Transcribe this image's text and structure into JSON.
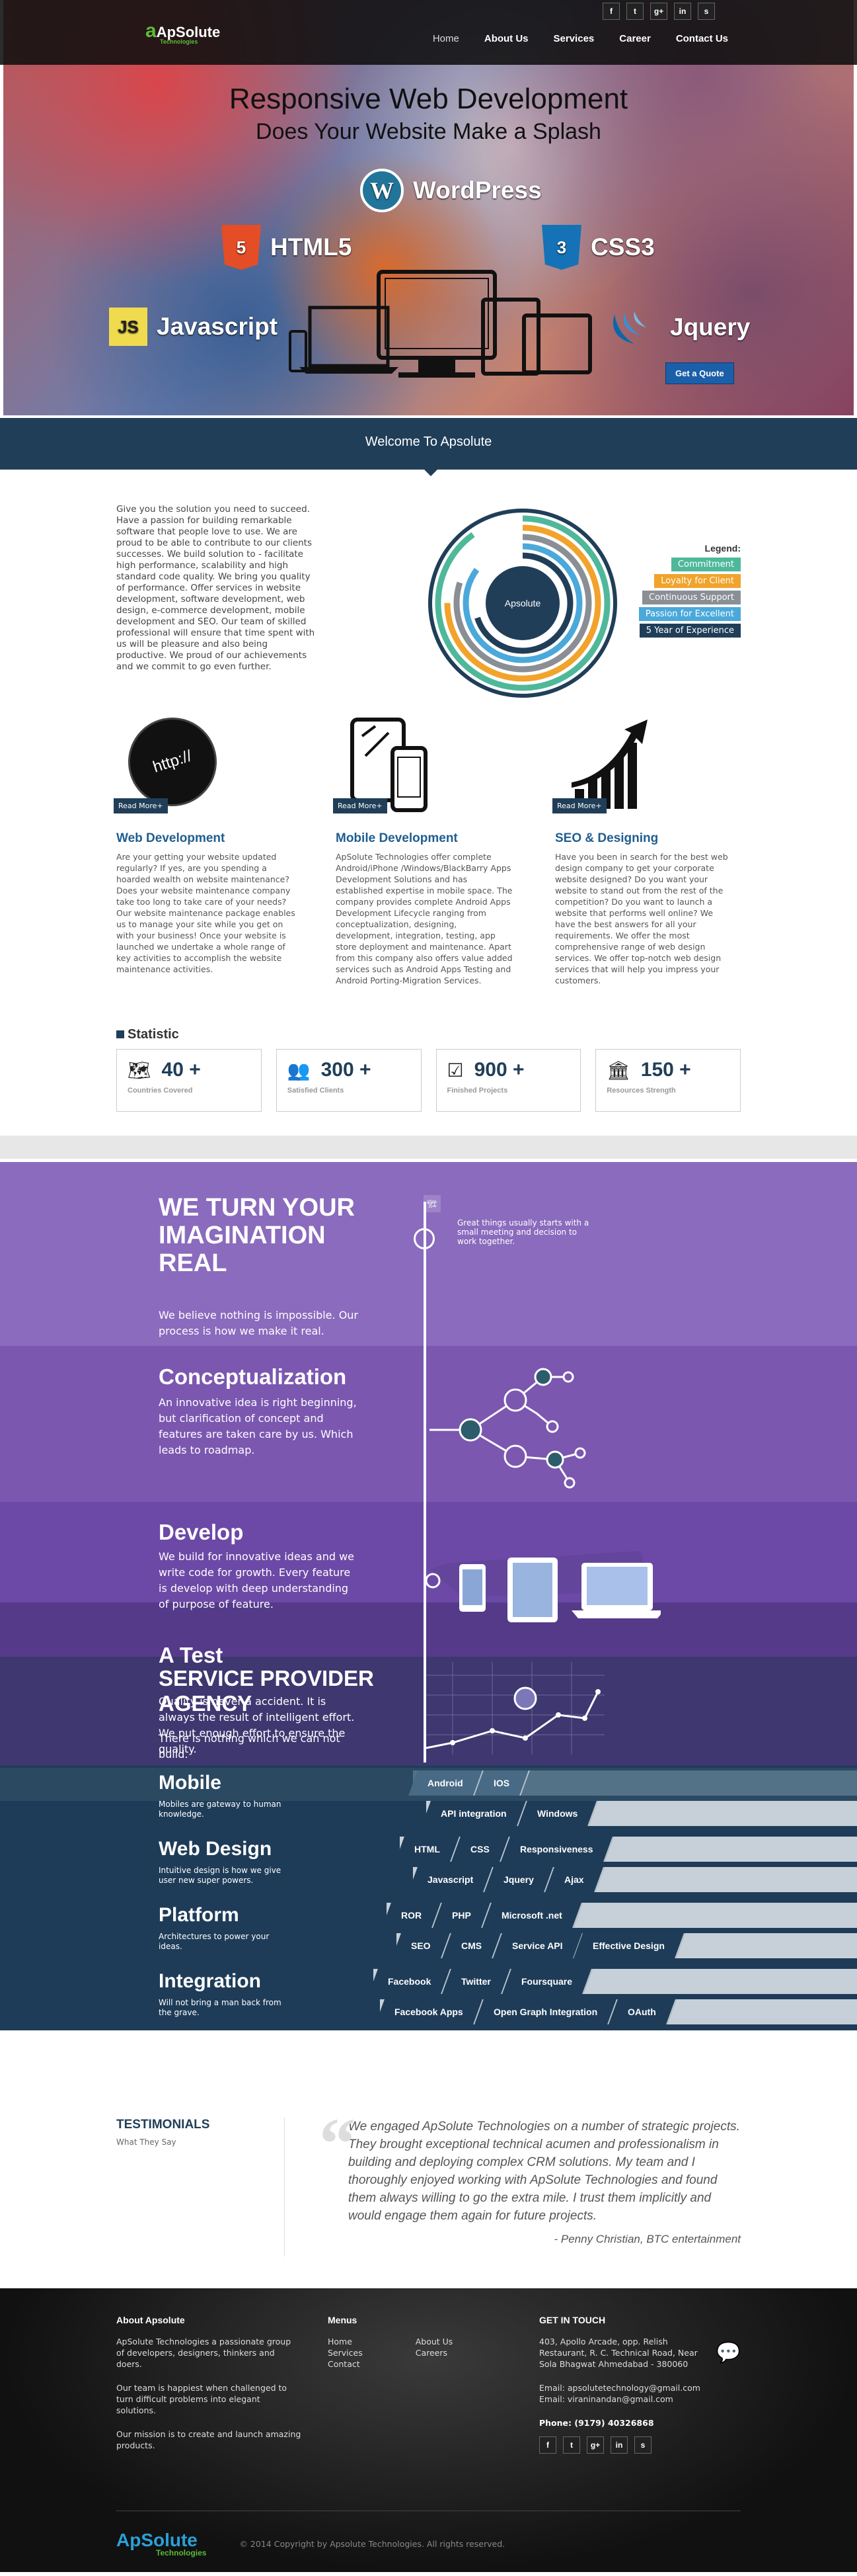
{
  "header": {
    "logo": {
      "mark": "a",
      "text": "ApSolute",
      "tagline": "Technologies"
    },
    "nav": [
      "Home",
      "About Us",
      "Services",
      "Career",
      "Contact Us"
    ],
    "social": [
      "f",
      "t",
      "g+",
      "in",
      "s"
    ]
  },
  "hero": {
    "title": "Responsive Web Development",
    "subtitle": "Does Your Website Make a Splash",
    "techs": [
      {
        "label": "WordPress",
        "icon": "W",
        "color": "#21759b"
      },
      {
        "label": "HTML5",
        "icon": "5",
        "color": "#e44d26"
      },
      {
        "label": "CSS3",
        "icon": "3",
        "color": "#1572b6"
      },
      {
        "label": "Javascript",
        "icon": "JS",
        "color": "#f0db4f"
      },
      {
        "label": "Jquery",
        "icon": "",
        "color": "#0868ac"
      }
    ],
    "quote_button": "Get a Quote"
  },
  "welcome": {
    "title": "Welcome To Apsolute"
  },
  "about": {
    "text": "Give you the solution you need to succeed. Have a passion for building remarkable software that people love to use. We are proud to be able to contribute to our clients successes. We build solution to - facilitate high performance, scalability and high standard code quality. We bring you quality of performance. Offer services in website development, software development, web design, e-commerce development, mobile development and SEO. Our team of skilled professional will ensure that time spent with us will be pleasure and also being productive. We proud of our achievements and we commit to go even further.",
    "donut_center": "Apsolute",
    "legend_title": "Legend:",
    "legend": [
      {
        "label": "Commitment",
        "color": "#4fb89b",
        "value": 0.9
      },
      {
        "label": "Loyalty for Client",
        "color": "#f1a32c",
        "value": 0.75
      },
      {
        "label": "Continuous Support",
        "color": "#8a8f95",
        "value": 0.8
      },
      {
        "label": "Passion for Excellent",
        "color": "#4aa9da",
        "value": 0.85
      },
      {
        "label": "5 Year of Experience",
        "color": "#203e58",
        "value": 0.7
      }
    ]
  },
  "services": [
    {
      "title": "Web Development",
      "read_more": "Read More+",
      "img_text": "http://",
      "text": "Are your getting your website updated regularly? If yes, are you spending a hoarded wealth on website maintenance? Does your website maintenance company take too long to take care of your needs? Our website maintenance package enables us to manage your site while you get on with your business! Once your website is launched we undertake a whole range of key activities to accomplish the website maintenance activities."
    },
    {
      "title": "Mobile Development",
      "read_more": "Read More+",
      "text": "ApSolute Technologies offer complete Android/iPhone /Windows/BlackBarry Apps Development Solutions and has established expertise in mobile space. The company provides complete Android Apps Development Lifecycle ranging from conceptualization, designing, development, integration, testing, app store deployment and maintenance. Apart from this company also offers value added services such as Android Apps Testing and Android Porting-Migration Services."
    },
    {
      "title": "SEO & Designing",
      "read_more": "Read More+",
      "text": "Have you been in search for the best web design company to get your corporate website designed? Do you want your website to stand out from the rest of the competition? Do you want to launch a website that performs well online? We have the best answers for all your requirements. We offer the most comprehensive range of web design services. We offer top-notch web design services that will help you impress your customers."
    }
  ],
  "statistics": {
    "title": "Statistic",
    "items": [
      {
        "value": "40 +",
        "label": "Countries Covered",
        "icon": "globe-icon"
      },
      {
        "value": "300 +",
        "label": "Satisfied Clients",
        "icon": "users-icon"
      },
      {
        "value": "900 +",
        "label": "Finished Projects",
        "icon": "checklist-icon"
      },
      {
        "value": "150 +",
        "label": "Resources Strength",
        "icon": "team-icon"
      }
    ]
  },
  "process": {
    "intro_title": "WE TURN YOUR IMAGINATION REAL",
    "intro_text": "We believe nothing is impossible. Our process is how we make it real.",
    "intro_note": "Great things usually starts with a small meeting and decision to work together.",
    "steps": [
      {
        "title": "Conceptualization",
        "text": "An innovative idea is right beginning, but clarification of concept and features are taken care by us. Which leads to roadmap."
      },
      {
        "title": "Develop",
        "text": "We build for innovative ideas and we write code for growth. Every feature is develop with deep understanding of purpose of feature."
      },
      {
        "title": "A Test",
        "title_overlap": "SERVICE PROVIDER AGENCY",
        "text": "Quality is never a accident. It is always the result of intelligent effort. We put enough effort to ensure the quality.",
        "text_overlap": "There is nothing which we can not build."
      }
    ],
    "tech_rows": [
      {
        "name": "Mobile",
        "sub": "Mobiles are gateway to human knowledge.",
        "chips1": [
          "Android",
          "IOS"
        ],
        "chips2": [
          "API integration",
          "Windows"
        ]
      },
      {
        "name": "Web Design",
        "sub": "Intuitive design is how we give user new super powers.",
        "chips1": [
          "HTML",
          "CSS",
          "Responsiveness"
        ],
        "chips2": [
          "Javascript",
          "Jquery",
          "Ajax"
        ]
      },
      {
        "name": "Platform",
        "sub": "Architectures to power your ideas.",
        "chips1": [
          "ROR",
          "PHP",
          "Microsoft .net"
        ],
        "chips2": [
          "SEO",
          "CMS",
          "Service API",
          "Effective Design"
        ]
      },
      {
        "name": "Integration",
        "sub": "Will not bring a man back from the grave.",
        "chips1": [
          "Facebook",
          "Twitter",
          "Foursquare"
        ],
        "chips2": [
          "Facebook Apps",
          "Open Graph Integration",
          "OAuth"
        ]
      }
    ]
  },
  "testimonials": {
    "title": "TESTIMONIALS",
    "subtitle": "What They Say",
    "quote": "We engaged ApSolute Technologies on a number of strategic projects. They brought exceptional technical acumen and professionalism in building and deploying complex CRM solutions. My team and I thoroughly enjoyed working with ApSolute Technologies and found them always willing to go the extra mile. I trust them implicitly and would engage them again for future projects.",
    "author": "- Penny Christian, BTC entertainment"
  },
  "footer": {
    "about_title": "About Apsolute",
    "about_p1": "ApSolute Technologies a passionate group of developers, designers, thinkers and doers.",
    "about_p2": "Our team is happiest when challenged to turn difficult problems into elegant solutions.",
    "about_p3": "Our mission is to create and launch amazing products.",
    "menus_title": "Menus",
    "menu_col1": [
      "Home",
      "Services",
      "Contact"
    ],
    "menu_col2": [
      "About Us",
      "Careers"
    ],
    "touch_title": "GET IN TOUCH",
    "address": "403, Apollo Arcade, opp. Relish Restaurant, R. C. Technical Road, Near Sola Bhagwat Ahmedabad - 380060",
    "email1": "Email: apsolutetechnology@gmail.com",
    "email2": "Email: viraninandan@gmail.com",
    "phone": "Phone: (9179) 40326868",
    "social": [
      "f",
      "t",
      "g+",
      "in",
      "s"
    ],
    "logo_text": "ApSolute",
    "logo_tagline": "Technologies",
    "copyright": "© 2014 Copyright by Apsolute Technologies. All rights reserved."
  }
}
